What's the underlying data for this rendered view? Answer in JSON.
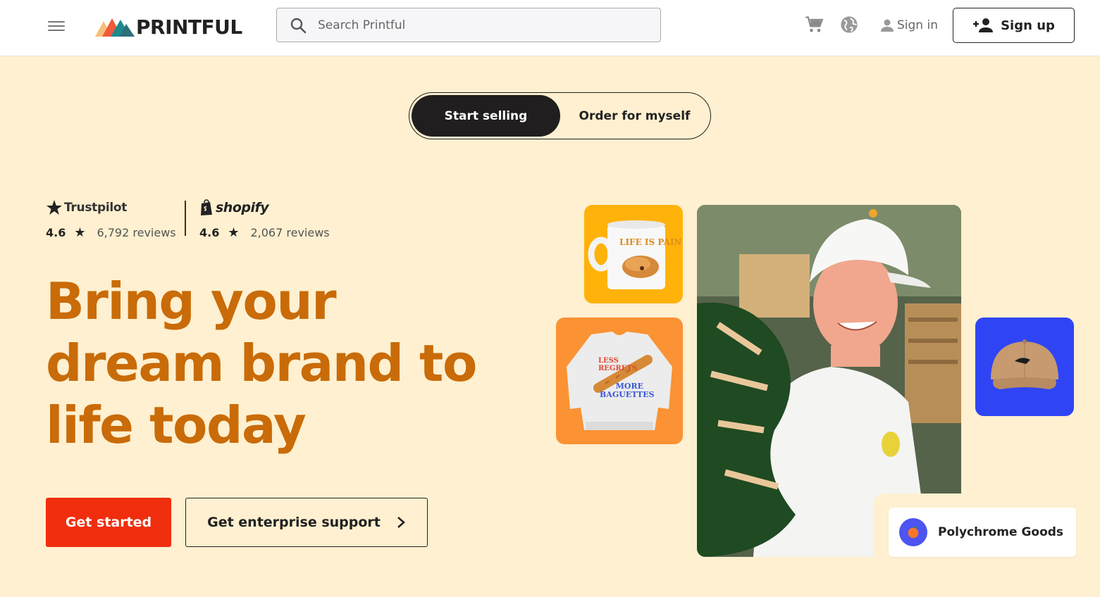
{
  "header": {
    "menu_icon": "hamburger-menu-icon",
    "logo_text": "PRINTFUL",
    "search": {
      "placeholder": "Search Printful"
    },
    "cart_icon": "cart-icon",
    "language_icon": "globe-icon",
    "sign_in_label": "Sign in",
    "sign_up_label": "Sign up"
  },
  "toggle": {
    "options": [
      {
        "label": "Start selling",
        "selected": true
      },
      {
        "label": "Order for myself",
        "selected": false
      }
    ]
  },
  "ratings": [
    {
      "brand": "Trustpilot",
      "score": "4.6",
      "reviews": "6,792 reviews"
    },
    {
      "brand": "shopify",
      "score": "4.6",
      "reviews": "2,067 reviews"
    }
  ],
  "hero": {
    "headline_lines": [
      "Bring your",
      "dream brand to",
      "life today"
    ],
    "cta_primary": "Get started",
    "cta_secondary": "Get enterprise support"
  },
  "products": {
    "mug_text": "LIFE IS PAIN",
    "sweatshirt_text_1": "LESS REGRETS",
    "sweatshirt_text_2": "MORE BAGUETTES"
  },
  "store_badge": {
    "label": "Polychrome Goods"
  },
  "colors": {
    "background": "#fef0d0",
    "headline": "#c96b08",
    "primary_button": "#f02e0e",
    "mug_tile": "#ffb20a",
    "sweatshirt_tile": "#fb9233",
    "cap_tile": "#2f45f5"
  }
}
